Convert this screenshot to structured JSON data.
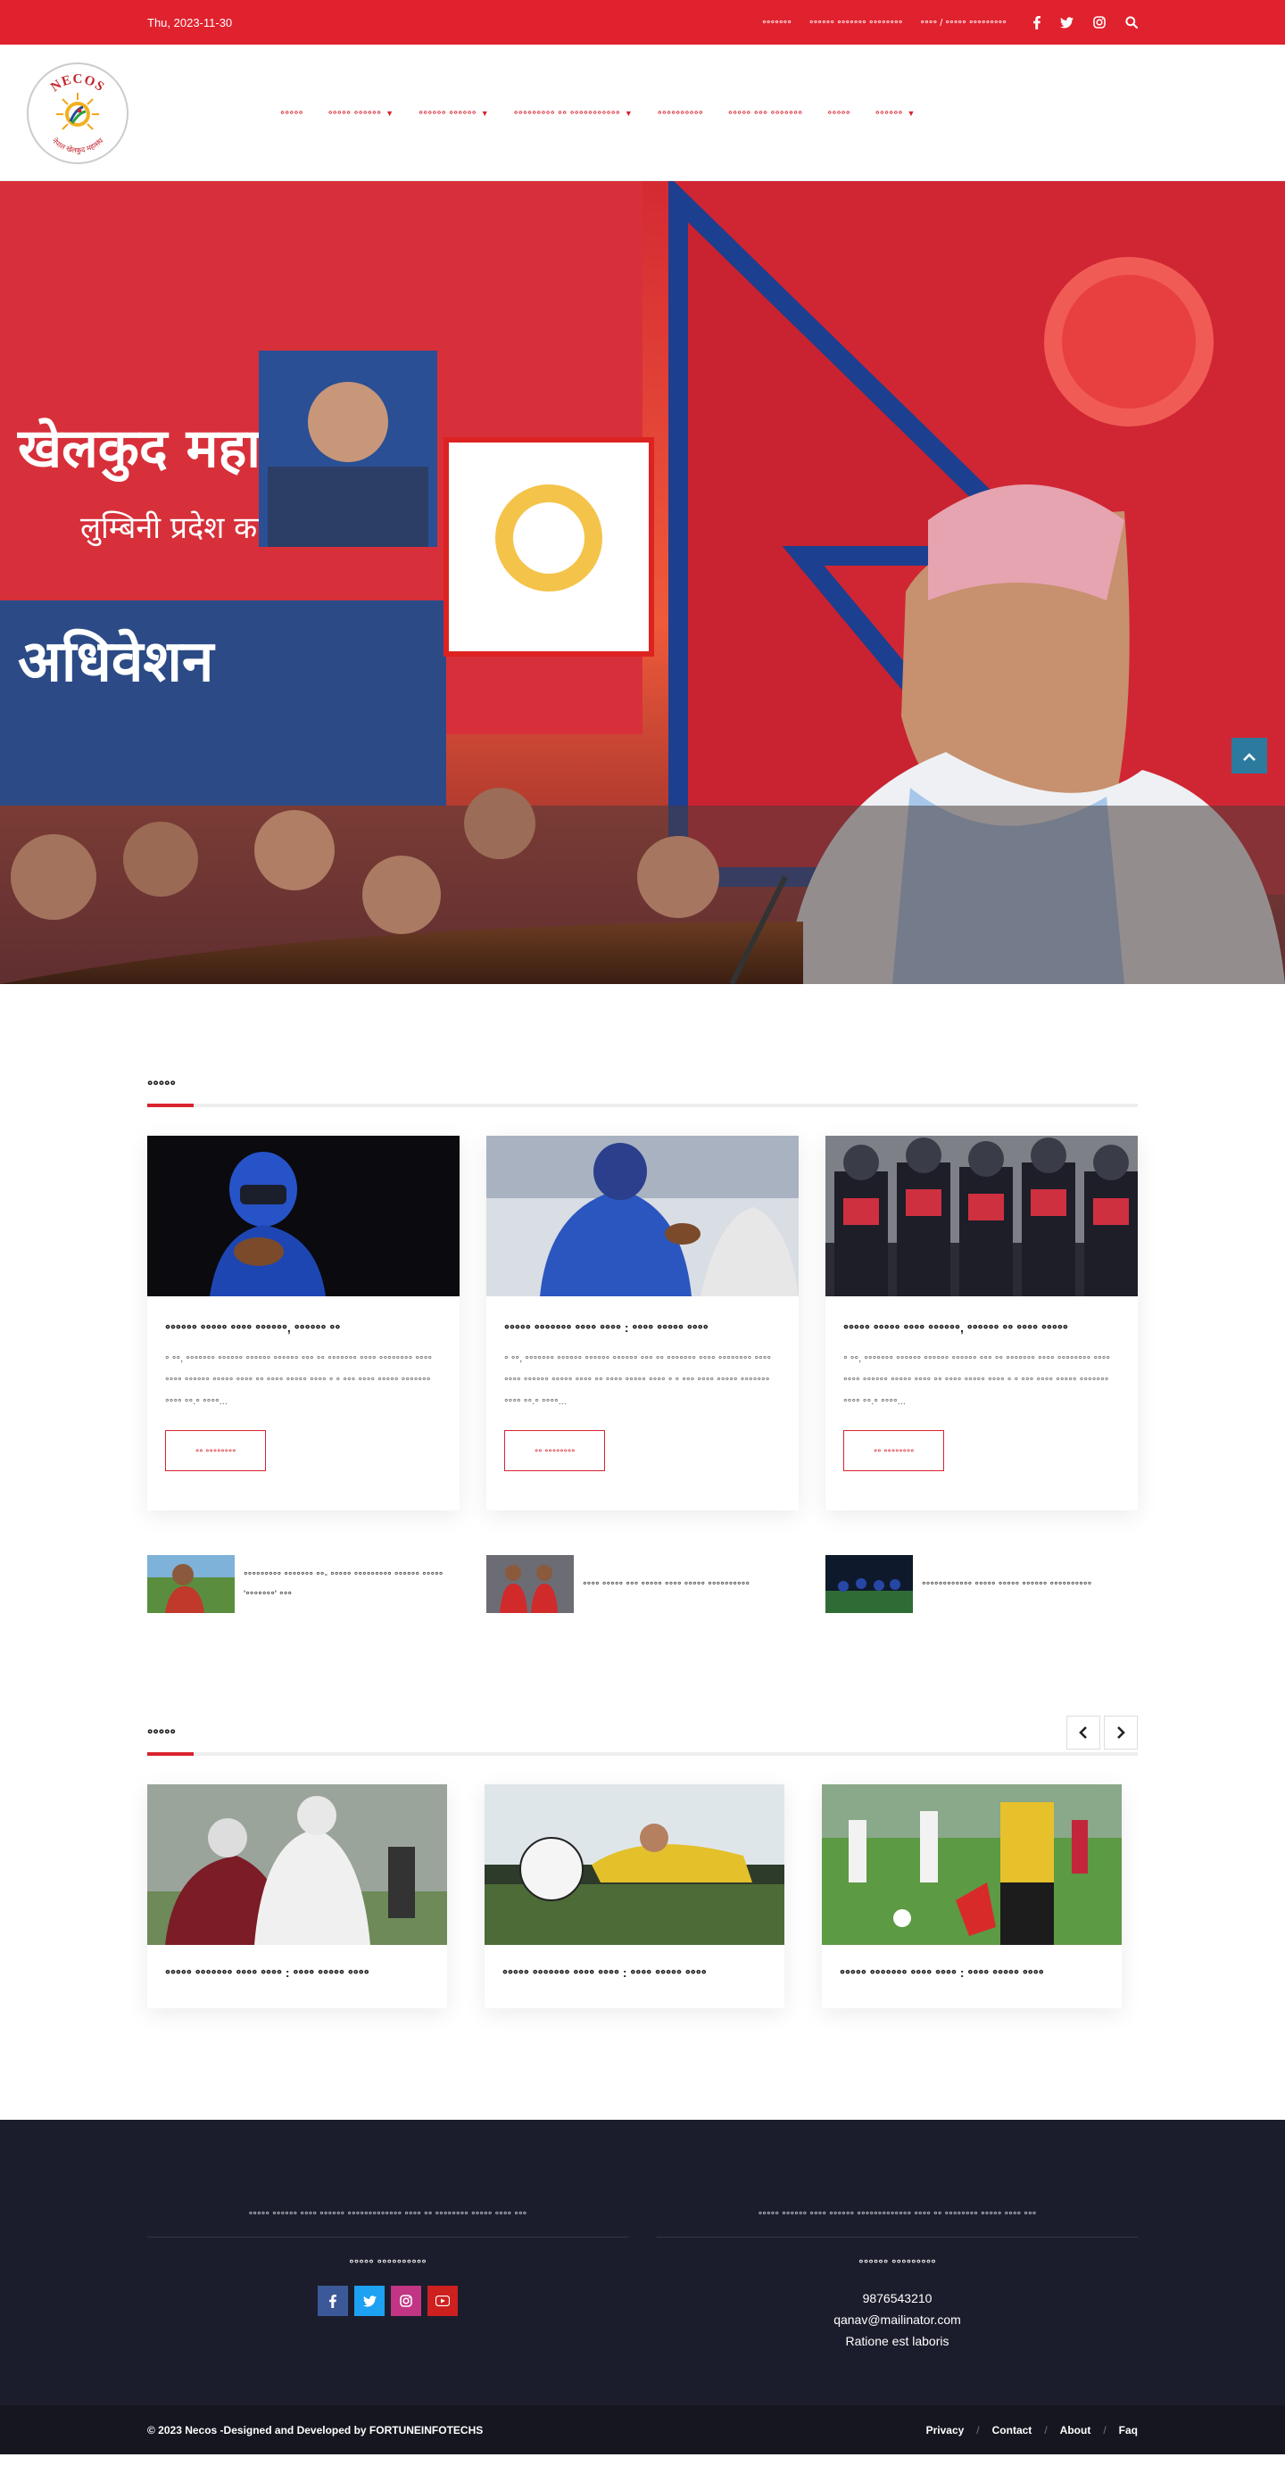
{
  "topbar": {
    "date": "Thu, 2023-11-30",
    "links": [
      "॰॰॰॰॰॰॰",
      "॰॰॰॰॰॰ ॰॰॰॰॰॰॰ ॰॰॰॰॰॰॰॰",
      "॰॰॰॰ / ॰॰॰॰॰ ॰॰॰॰॰॰॰॰॰"
    ],
    "icons": [
      "facebook-icon",
      "twitter-icon",
      "instagram-icon",
      "search-icon"
    ]
  },
  "header": {
    "logo_text": "NECOS",
    "logo_subtext": "नेपाल खेलकुद महासंघ",
    "nav": [
      {
        "label": "॰॰॰॰॰",
        "dropdown": false
      },
      {
        "label": "॰॰॰॰॰ ॰॰॰॰॰॰",
        "dropdown": true
      },
      {
        "label": "॰॰॰॰॰॰ ॰॰॰॰॰॰",
        "dropdown": true
      },
      {
        "label": "॰॰॰॰॰॰॰॰॰ ॰॰ ॰॰॰॰॰॰॰॰॰॰॰",
        "dropdown": true
      },
      {
        "label": "॰॰॰॰॰॰॰॰॰॰",
        "dropdown": false
      },
      {
        "label": "॰॰॰॰॰ ॰॰॰ ॰॰॰॰॰॰॰",
        "dropdown": false
      },
      {
        "label": "॰॰॰॰॰",
        "dropdown": false
      },
      {
        "label": "॰॰॰॰॰॰",
        "dropdown": true
      }
    ]
  },
  "hero": {
    "banner_lines": [
      "खेलकुद महासंघ",
      "लुम्बिनी प्रदेश कमिटी",
      "अधिवेशन"
    ],
    "back_to_top_icon": "chevron-up-icon"
  },
  "news": {
    "title": "॰॰॰॰॰",
    "cards": [
      {
        "title": "॰॰॰॰॰॰ ॰॰॰॰॰ ॰॰॰॰ ॰॰॰॰॰॰, ॰॰॰॰॰॰ ॰॰",
        "excerpt": "॰ ॰॰, ॰॰॰॰॰॰॰ ॰॰॰॰॰॰ ॰॰॰॰॰॰ ॰॰॰॰॰॰ ॰॰॰ ॰॰ ॰॰॰॰॰॰॰ ॰॰॰॰ ॰॰॰॰॰॰॰॰ ॰॰॰॰ ॰॰॰॰ ॰॰॰॰॰॰ ॰॰॰॰॰ ॰॰॰॰ ॰॰ ॰॰॰॰ ॰॰॰॰॰ ॰॰॰॰ ॰ ॰ ॰॰॰ ॰॰॰॰ ॰॰॰॰॰ ॰॰॰॰॰॰॰ ॰॰॰॰ ॰॰.॰ ॰॰॰॰...",
        "button": "॰॰ ॰॰॰॰॰॰॰॰"
      },
      {
        "title": "॰॰॰॰॰ ॰॰॰॰॰॰॰ ॰॰॰॰ ॰॰॰॰ : ॰॰॰॰ ॰॰॰॰॰ ॰॰॰॰",
        "excerpt": "॰ ॰॰, ॰॰॰॰॰॰॰ ॰॰॰॰॰॰ ॰॰॰॰॰॰ ॰॰॰॰॰॰ ॰॰॰ ॰॰ ॰॰॰॰॰॰॰ ॰॰॰॰ ॰॰॰॰॰॰॰॰ ॰॰॰॰ ॰॰॰॰ ॰॰॰॰॰॰ ॰॰॰॰॰ ॰॰॰॰ ॰॰ ॰॰॰॰ ॰॰॰॰॰ ॰॰॰॰ ॰ ॰ ॰॰॰ ॰॰॰॰ ॰॰॰॰॰ ॰॰॰॰॰॰॰ ॰॰॰॰ ॰॰.॰ ॰॰॰॰...",
        "button": "॰॰ ॰॰॰॰॰॰॰॰"
      },
      {
        "title": "॰॰॰॰॰ ॰॰॰॰॰ ॰॰॰॰ ॰॰॰॰॰॰, ॰॰॰॰॰॰ ॰॰ ॰॰॰॰ ॰॰॰॰॰",
        "excerpt": "॰ ॰॰, ॰॰॰॰॰॰॰ ॰॰॰॰॰॰ ॰॰॰॰॰॰ ॰॰॰॰॰॰ ॰॰॰ ॰॰ ॰॰॰॰॰॰॰ ॰॰॰॰ ॰॰॰॰॰॰॰॰ ॰॰॰॰ ॰॰॰॰ ॰॰॰॰॰॰ ॰॰॰॰॰ ॰॰॰॰ ॰॰ ॰॰॰॰ ॰॰॰॰॰ ॰॰॰॰ ॰ ॰ ॰॰॰ ॰॰॰॰ ॰॰॰॰॰ ॰॰॰॰॰॰॰ ॰॰॰॰ ॰॰.॰ ॰॰॰॰...",
        "button": "॰॰ ॰॰॰॰॰॰॰॰"
      }
    ],
    "mini": [
      {
        "text": "॰॰॰॰॰॰॰॰॰ ॰॰॰॰॰॰॰ ॰॰- ॰॰॰॰॰ ॰॰॰॰॰॰॰॰॰ ॰॰॰॰॰॰ ॰॰॰॰॰ '॰॰॰॰॰॰॰' ॰॰॰"
      },
      {
        "text": "॰॰॰॰ ॰॰॰॰॰ ॰॰॰ ॰॰॰॰॰ ॰॰॰॰ ॰॰॰॰॰ ॰॰॰॰॰॰॰॰॰॰"
      },
      {
        "text": "॰॰॰॰॰॰॰॰॰॰॰॰ ॰॰॰॰॰ ॰॰॰॰॰ ॰॰॰॰॰॰ ॰॰॰॰॰॰॰॰॰॰"
      }
    ]
  },
  "videos": {
    "title": "॰॰॰॰॰",
    "prev_icon": "chevron-left-icon",
    "next_icon": "chevron-right-icon",
    "items": [
      {
        "title": "॰॰॰॰॰ ॰॰॰॰॰॰॰ ॰॰॰॰ ॰॰॰॰ : ॰॰॰॰ ॰॰॰॰॰ ॰॰॰॰"
      },
      {
        "title": "॰॰॰॰॰ ॰॰॰॰॰॰॰ ॰॰॰॰ ॰॰॰॰ : ॰॰॰॰ ॰॰॰॰॰ ॰॰॰॰"
      },
      {
        "title": "॰॰॰॰॰ ॰॰॰॰॰॰॰ ॰॰॰॰ ॰॰॰॰ : ॰॰॰॰ ॰॰॰॰॰ ॰॰॰॰"
      }
    ]
  },
  "footer": {
    "left": {
      "desc": "॰॰॰॰॰ ॰॰॰॰॰॰ ॰॰॰॰ ॰॰॰॰॰॰ ॰॰॰॰॰॰॰॰॰॰॰॰॰ ॰॰॰॰ ॰॰ ॰॰॰॰॰॰॰॰ ॰॰॰॰॰ ॰॰॰॰ ॰॰॰",
      "title": "॰॰॰॰॰ ॰॰॰॰॰॰॰॰॰॰",
      "socials": [
        {
          "icon": "facebook-icon",
          "glyph": "f",
          "color": "#3b5998"
        },
        {
          "icon": "twitter-icon",
          "glyph": "t",
          "color": "#1da1f2"
        },
        {
          "icon": "instagram-icon",
          "glyph": "◎",
          "color": "#c13584"
        },
        {
          "icon": "youtube-icon",
          "glyph": "▶",
          "color": "#cd201f"
        }
      ]
    },
    "right": {
      "desc": "॰॰॰॰॰ ॰॰॰॰॰॰ ॰॰॰॰ ॰॰॰॰॰॰ ॰॰॰॰॰॰॰॰॰॰॰॰॰ ॰॰॰॰ ॰॰ ॰॰॰॰॰॰॰॰ ॰॰॰॰॰ ॰॰॰॰ ॰॰॰",
      "title": "॰॰॰॰॰॰ ॰॰॰॰॰॰॰॰॰",
      "phone": "9876543210",
      "email": "qanav@mailinator.com",
      "address": "Ratione est laboris"
    }
  },
  "bottombar": {
    "copyright": "© 2023 Necos -Designed and Developed by FORTUNEINFOTECHS",
    "links": [
      "Privacy",
      "Contact",
      "About",
      "Faq"
    ]
  },
  "colors": {
    "brand_red": "#e0212e",
    "footer_bg": "#1c1d2c"
  }
}
